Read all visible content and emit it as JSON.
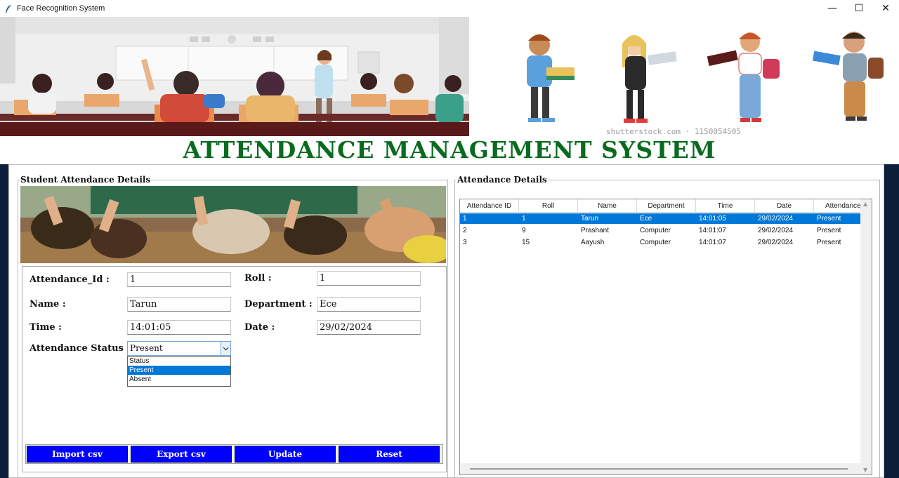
{
  "window": {
    "title": "Face Recognition System",
    "controls": {
      "minimize": "—",
      "maximize": "☐",
      "close": "✕"
    }
  },
  "banner": {
    "watermark": "shutterstock.com · 1150054505"
  },
  "heading": "ATTENDANCE MANAGEMENT SYSTEM",
  "left_panel": {
    "legend": "Student Attendance Details",
    "form": {
      "attendance_id": {
        "label": "Attendance_Id :",
        "value": "1"
      },
      "roll": {
        "label": "Roll :",
        "value": "1"
      },
      "name": {
        "label": "Name :",
        "value": "Tarun"
      },
      "department": {
        "label": "Department :",
        "value": "Ece"
      },
      "time": {
        "label": "Time :",
        "value": "14:01:05"
      },
      "date": {
        "label": "Date :",
        "value": "29/02/2024"
      },
      "status": {
        "label": "Attendance Status :",
        "value": "Present",
        "options": [
          "Status",
          "Present",
          "Absent"
        ],
        "highlighted": "Present"
      }
    },
    "buttons": {
      "import": "Import csv",
      "export": "Export csv",
      "update": "Update",
      "reset": "Reset"
    }
  },
  "right_panel": {
    "legend": "Attendance Details",
    "table": {
      "columns": [
        "Attendance ID",
        "Roll",
        "Name",
        "Department",
        "Time",
        "Date",
        "Attendance"
      ],
      "rows": [
        [
          "1",
          "1",
          "Tarun",
          "Ece",
          "14:01:05",
          "29/02/2024",
          "Present"
        ],
        [
          "2",
          "9",
          "Prashant",
          "Computer",
          "14:01:07",
          "29/02/2024",
          "Present"
        ],
        [
          "3",
          "15",
          "Aayush",
          "Computer",
          "14:01:07",
          "29/02/2024",
          "Present"
        ]
      ],
      "selected_row": 0
    }
  },
  "colors": {
    "heading": "#0a6b1f",
    "button": "#0000ff",
    "selection": "#0078d7"
  }
}
